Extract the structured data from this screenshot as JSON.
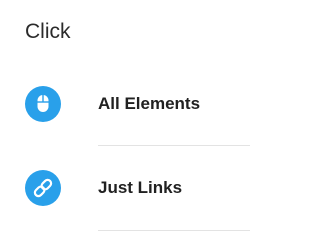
{
  "section": {
    "title": "Click"
  },
  "options": [
    {
      "label": "All Elements",
      "icon": "mouse-icon"
    },
    {
      "label": "Just Links",
      "icon": "link-icon"
    }
  ],
  "colors": {
    "icon_background": "#29a0ea",
    "icon_foreground": "#ffffff",
    "divider": "#e3e3e3"
  }
}
